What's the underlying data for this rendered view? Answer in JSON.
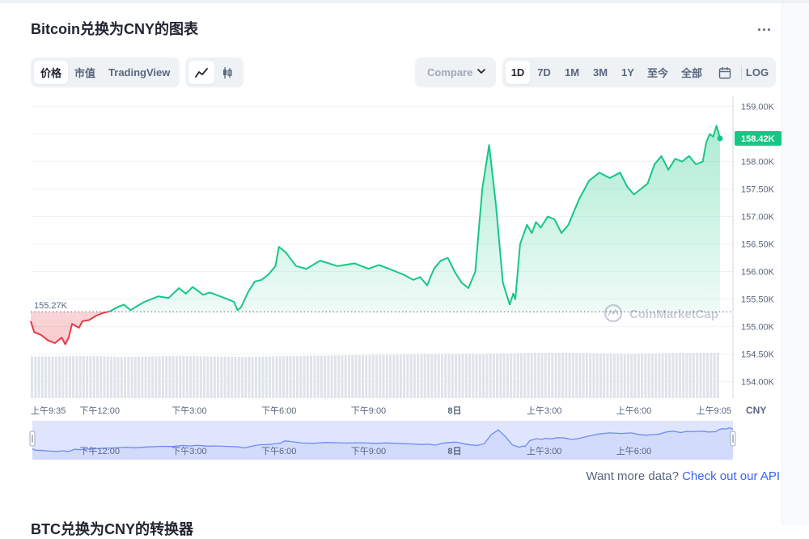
{
  "header": {
    "title": "Bitcoin兑换为CNY的图表",
    "more_label": "..."
  },
  "view_tabs": [
    {
      "label": "价格",
      "active": true
    },
    {
      "label": "市值",
      "active": false
    },
    {
      "label": "TradingView",
      "active": false
    }
  ],
  "chart_style_tabs": [
    {
      "icon": "line-chart-icon",
      "active": true
    },
    {
      "icon": "candlestick-icon",
      "active": false
    }
  ],
  "compare": {
    "label": "Compare"
  },
  "range_tabs": [
    {
      "label": "1D",
      "active": true
    },
    {
      "label": "7D",
      "active": false
    },
    {
      "label": "1M",
      "active": false
    },
    {
      "label": "3M",
      "active": false
    },
    {
      "label": "1Y",
      "active": false
    },
    {
      "label": "至今",
      "active": false
    },
    {
      "label": "全部",
      "active": false
    },
    {
      "icon": "calendar-icon",
      "active": false
    },
    {
      "label": "LOG",
      "active": false
    }
  ],
  "watermark": "CoinMarketCap",
  "colors": {
    "up": "#16c784",
    "down": "#ea3943",
    "brand_link": "#3861fb",
    "navigator_fill": "#dfe5fc",
    "navigator_line": "#6d8cf5"
  },
  "chart_data": {
    "type": "line",
    "currency": "CNY",
    "ylim": [
      153.7,
      159.2
    ],
    "y_ticks": [
      {
        "value": 159.0,
        "label": "159.00K"
      },
      {
        "value": 158.5,
        "label": "158.50K"
      },
      {
        "value": 158.0,
        "label": "158.00K"
      },
      {
        "value": 157.5,
        "label": "157.50K"
      },
      {
        "value": 157.0,
        "label": "157.00K"
      },
      {
        "value": 156.5,
        "label": "156.50K"
      },
      {
        "value": 156.0,
        "label": "156.00K"
      },
      {
        "value": 155.5,
        "label": "155.50K"
      },
      {
        "value": 155.0,
        "label": "155.00K"
      },
      {
        "value": 154.5,
        "label": "154.50K"
      },
      {
        "value": 154.0,
        "label": "154.00K"
      }
    ],
    "x_ticks": [
      {
        "t": 0.0,
        "label": "上午9:35"
      },
      {
        "t": 0.1,
        "label": "下午12:00"
      },
      {
        "t": 0.23,
        "label": "下午3:00"
      },
      {
        "t": 0.36,
        "label": "下午6:00"
      },
      {
        "t": 0.49,
        "label": "下午9:00"
      },
      {
        "t": 0.615,
        "label": "8日"
      },
      {
        "t": 0.745,
        "label": "上午3:00"
      },
      {
        "t": 0.875,
        "label": "上午6:00"
      },
      {
        "t": 1.0,
        "label": "上午9:05"
      }
    ],
    "navigator_ticks": [
      {
        "t": 0.1,
        "label": "下午12:00"
      },
      {
        "t": 0.23,
        "label": "下午3:00"
      },
      {
        "t": 0.36,
        "label": "下午6:00"
      },
      {
        "t": 0.49,
        "label": "下午9:00"
      },
      {
        "t": 0.615,
        "label": "8日"
      },
      {
        "t": 0.745,
        "label": "上午3:00"
      },
      {
        "t": 0.875,
        "label": "上午6:00"
      }
    ],
    "baseline": {
      "value": 155.27,
      "label": "155.27K"
    },
    "current": {
      "value": 158.42,
      "label": "158.42K"
    },
    "series": [
      {
        "t": [
          0.0,
          0.005,
          0.015,
          0.025,
          0.035,
          0.045,
          0.05,
          0.055,
          0.06,
          0.07,
          0.075,
          0.085,
          0.095,
          0.105,
          0.115,
          0.125,
          0.135,
          0.145,
          0.155,
          0.165,
          0.175,
          0.185,
          0.2,
          0.215,
          0.225,
          0.235,
          0.25,
          0.26,
          0.275,
          0.285,
          0.295,
          0.3,
          0.305,
          0.315,
          0.325,
          0.335,
          0.345,
          0.355,
          0.36,
          0.37,
          0.385,
          0.4,
          0.42,
          0.445,
          0.47,
          0.49,
          0.505,
          0.52,
          0.54,
          0.555,
          0.565,
          0.575,
          0.585,
          0.595,
          0.605,
          0.615,
          0.625,
          0.635,
          0.645,
          0.655,
          0.665,
          0.675,
          0.685,
          0.695,
          0.7,
          0.703,
          0.71,
          0.72,
          0.727,
          0.733,
          0.74,
          0.75,
          0.76,
          0.77,
          0.78,
          0.795,
          0.81,
          0.825,
          0.84,
          0.855,
          0.865,
          0.875,
          0.885,
          0.895,
          0.905,
          0.915,
          0.925,
          0.935,
          0.945,
          0.955,
          0.965,
          0.975,
          0.98,
          0.985,
          0.99,
          0.995,
          1.0
        ],
        "values": [
          155.1,
          154.9,
          154.85,
          154.75,
          154.7,
          154.8,
          154.68,
          154.8,
          155.05,
          154.98,
          155.1,
          155.12,
          155.2,
          155.25,
          155.28,
          155.35,
          155.4,
          155.3,
          155.38,
          155.45,
          155.5,
          155.55,
          155.52,
          155.7,
          155.6,
          155.72,
          155.58,
          155.62,
          155.55,
          155.5,
          155.45,
          155.3,
          155.35,
          155.62,
          155.82,
          155.85,
          155.95,
          156.1,
          156.45,
          156.35,
          156.1,
          156.05,
          156.2,
          156.1,
          156.15,
          156.05,
          156.12,
          156.05,
          155.95,
          155.85,
          155.9,
          155.75,
          156.05,
          156.2,
          156.25,
          156.0,
          155.8,
          155.7,
          156.0,
          157.5,
          158.3,
          157.2,
          155.8,
          155.4,
          155.6,
          155.5,
          156.5,
          156.85,
          156.7,
          156.9,
          156.8,
          157.0,
          156.95,
          156.7,
          156.85,
          157.3,
          157.65,
          157.8,
          157.7,
          157.8,
          157.55,
          157.4,
          157.5,
          157.6,
          157.95,
          158.1,
          157.85,
          158.05,
          158.0,
          158.1,
          157.95,
          158.0,
          158.35,
          158.5,
          158.45,
          158.65,
          158.42
        ]
      }
    ],
    "volume": [
      0.92,
      0.92,
      0.93,
      0.91,
      0.92,
      0.93,
      0.92,
      0.91,
      0.92,
      0.93,
      0.94,
      0.95,
      0.96,
      0.97,
      0.98,
      0.98,
      0.99,
      1.0,
      1.0,
      0.99,
      0.98,
      0.99,
      1.0,
      1.0
    ]
  },
  "footer": {
    "api_prompt": "Want more data?",
    "api_link": "Check out our API",
    "converter_title": "BTC兑换为CNY的转换器"
  }
}
